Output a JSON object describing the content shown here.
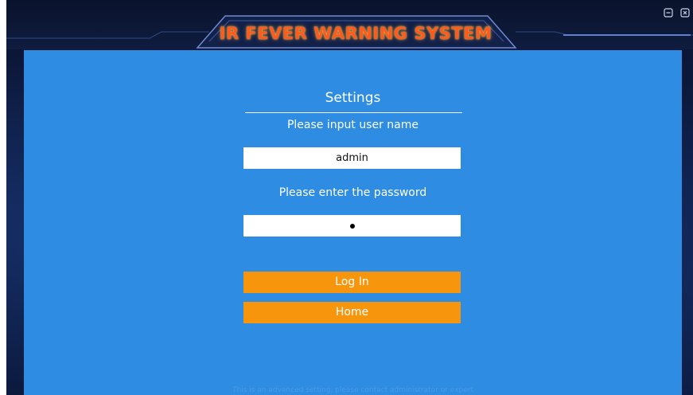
{
  "header": {
    "title": "IR FEVER WARNING SYSTEM",
    "minimize_icon": "minimize-icon",
    "close_icon": "close-icon"
  },
  "settings": {
    "title": "Settings",
    "username_label": "Please input user name",
    "username_value": "admin",
    "password_label": "Please enter the password",
    "password_masked_length": 1,
    "login_button": "Log In",
    "home_button": "Home"
  },
  "footer": {
    "note": "This is an advanced setting, please contact administrator or expert"
  },
  "colors": {
    "panel": "#2e8de2",
    "button": "#f7950c",
    "title": "#ff5a1e",
    "background": "#0b1533"
  }
}
